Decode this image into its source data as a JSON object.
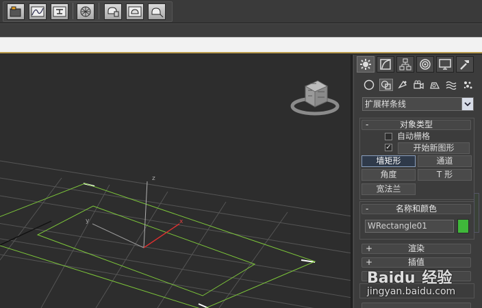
{
  "toolbar": {
    "icons": [
      "layer-manager-icon",
      "curve-editor-icon",
      "schematic-view-icon",
      "material-editor-icon",
      "render-setup-icon",
      "rendered-frame-icon",
      "render-production-icon"
    ]
  },
  "viewport": {
    "axis_labels": {
      "z": "z",
      "y": "y",
      "x": "x"
    },
    "colors": {
      "grid": "#5a5a5a",
      "shape_outline": "#7ec83a",
      "selection_bracket": "#ffffff",
      "x_axis": "#e03030",
      "tripod": "#b0b0b0"
    }
  },
  "panel": {
    "tabs": [
      "create-tab",
      "modify-tab",
      "hierarchy-tab",
      "motion-tab",
      "display-tab",
      "utilities-tab"
    ],
    "subcategories": [
      "geometry-icon",
      "shapes-icon",
      "lights-icon",
      "cameras-icon",
      "helpers-icon",
      "space-warps-icon",
      "systems-icon"
    ],
    "category_dropdown": "扩展样条线",
    "object_type": {
      "header": "对象类型",
      "sign": "-",
      "auto_grid": "自动栅格",
      "auto_grid_checked": false,
      "start_new_shape": "开始新图形",
      "start_new_shape_checked": true,
      "check_mark": "✓",
      "buttons": [
        {
          "label": "墙矩形",
          "active": true
        },
        {
          "label": "通道",
          "active": false
        },
        {
          "label": "角度",
          "active": false
        },
        {
          "label": "T 形",
          "active": false
        },
        {
          "label": "宽法兰",
          "active": false
        }
      ]
    },
    "name_color": {
      "header": "名称和颜色",
      "sign": "-",
      "name_value": "WRectangle01",
      "color": "#3fb83a"
    },
    "rollouts_collapsed": [
      {
        "sign": "+",
        "title": "渲染"
      },
      {
        "sign": "+",
        "title": "插值"
      }
    ]
  },
  "watermark": {
    "brand": "Baidu",
    "cn": "经验",
    "url": "jingyan.baidu.com"
  }
}
